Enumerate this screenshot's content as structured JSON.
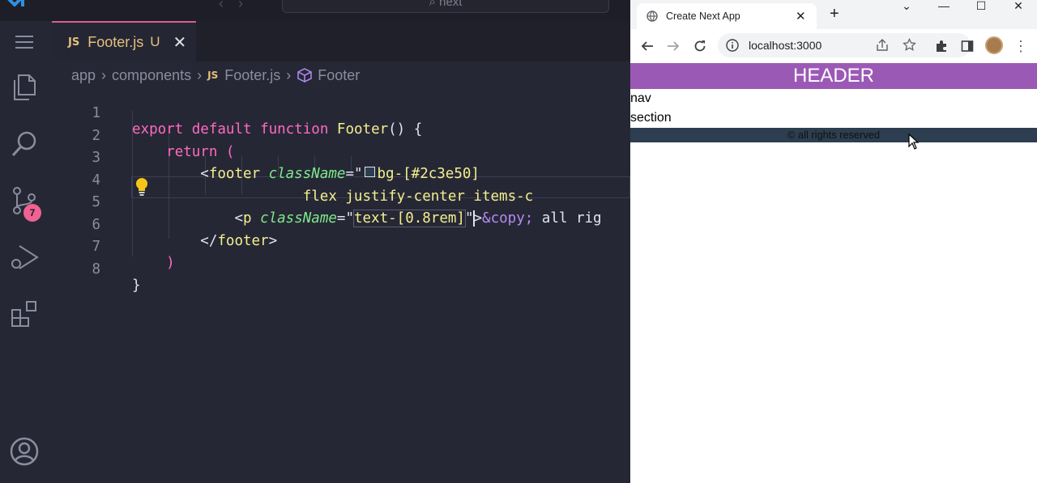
{
  "vscode": {
    "title_search": "next",
    "tab": {
      "lang": "JS",
      "name": "Footer.js",
      "status": "U"
    },
    "breadcrumb": {
      "part1": "app",
      "part2": "components",
      "lang": "JS",
      "file": "Footer.js",
      "symbol": "Footer"
    },
    "scm_badge": "7",
    "line_numbers": [
      "1",
      "2",
      "3",
      "4",
      "5",
      "6",
      "7",
      "8"
    ],
    "code": {
      "l1_export": "export",
      "l1_default": "default",
      "l1_function": "function",
      "l1_name": "Footer",
      "l1_rest": "() {",
      "l2_return": "return",
      "l2_paren": "(",
      "l3_open": "<",
      "l3_tag": "footer",
      "l3_attr": "className",
      "l3_eq": "=\"",
      "l3_value": "bg-[#2c3e50]",
      "l4_value": "flex justify-center items-c",
      "l5_open": "<",
      "l5_tag": "p",
      "l5_attr": "className",
      "l5_eq": "=\"",
      "l5_value": "text-[0.8rem]",
      "l5_close_quote": "\"",
      "l5_gt": ">",
      "l5_entity": "&copy;",
      "l5_text": " all rig",
      "l6_close": "</",
      "l6_tag": "footer",
      "l6_gt": ">",
      "l7_paren": ")",
      "l8_brace": "}"
    }
  },
  "browser": {
    "tab_title": "Create Next App",
    "url": "localhost:3000",
    "page": {
      "header": "HEADER",
      "nav": "nav",
      "section": "section",
      "footer": "© all rights reserved"
    }
  },
  "colors": {
    "header_bg": "#9b59b6",
    "footer_bg": "#2c3e50",
    "tab_accent": "#d95e8d",
    "badge": "#f06292"
  }
}
